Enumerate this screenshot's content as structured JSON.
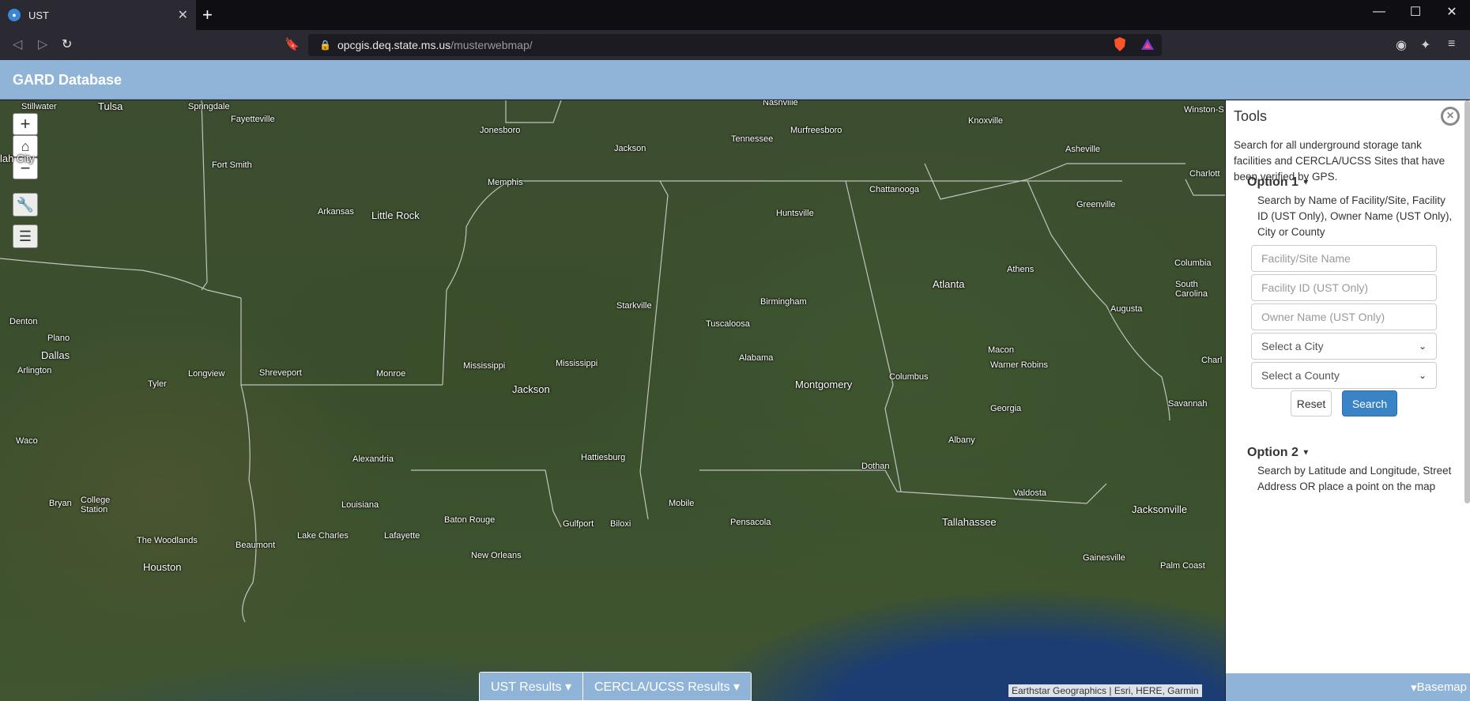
{
  "browser": {
    "tab_title": "UST",
    "new_tab": "+",
    "url_host": "opcgis.deq.state.ms.us",
    "url_path": "/musterwebmap/"
  },
  "app": {
    "title": "GARD Database"
  },
  "map": {
    "controls": {
      "zoom_in": "+",
      "zoom_out": "−"
    },
    "labels": [
      {
        "text": "Stillwater"
      },
      {
        "text": "Tulsa"
      },
      {
        "text": "Springdale"
      },
      {
        "text": "Fayetteville"
      },
      {
        "text": "Nashville"
      },
      {
        "text": "Murfreesboro"
      },
      {
        "text": "Tennessee"
      },
      {
        "text": "Knoxville"
      },
      {
        "text": "Winston-S"
      },
      {
        "text": "Asheville"
      },
      {
        "text": "Jonesboro"
      },
      {
        "text": "Jackson"
      },
      {
        "text": "Memphis"
      },
      {
        "text": "Chattanooga"
      },
      {
        "text": "Charlott"
      },
      {
        "text": "Greenville"
      },
      {
        "text": "Fort Smith"
      },
      {
        "text": "lah City"
      },
      {
        "text": "Arkansas"
      },
      {
        "text": "Little Rock"
      },
      {
        "text": "Huntsville"
      },
      {
        "text": "Atlanta"
      },
      {
        "text": "Athens"
      },
      {
        "text": "Columbia"
      },
      {
        "text": "South Carolina"
      },
      {
        "text": "Augusta"
      },
      {
        "text": "Birmingham"
      },
      {
        "text": "Starkville"
      },
      {
        "text": "Tuscaloosa"
      },
      {
        "text": "Denton"
      },
      {
        "text": "Plano"
      },
      {
        "text": "Dallas"
      },
      {
        "text": "Arlington"
      },
      {
        "text": "Macon"
      },
      {
        "text": "Warner Robins"
      },
      {
        "text": "Mississippi"
      },
      {
        "text": "Mississippi"
      },
      {
        "text": "Alabama"
      },
      {
        "text": "Longview"
      },
      {
        "text": "Shreveport"
      },
      {
        "text": "Monroe"
      },
      {
        "text": "Columbus"
      },
      {
        "text": "Montgomery"
      },
      {
        "text": "Charl"
      },
      {
        "text": "Tyler"
      },
      {
        "text": "Jackson"
      },
      {
        "text": "Georgia"
      },
      {
        "text": "Savannah"
      },
      {
        "text": "Waco"
      },
      {
        "text": "Alexandria"
      },
      {
        "text": "Hattiesburg"
      },
      {
        "text": "Albany"
      },
      {
        "text": "Dothan"
      },
      {
        "text": "Bryan"
      },
      {
        "text": "College Station"
      },
      {
        "text": "Louisiana"
      },
      {
        "text": "Valdosta"
      },
      {
        "text": "Mobile"
      },
      {
        "text": "Baton Rouge"
      },
      {
        "text": "Gulfport"
      },
      {
        "text": "Biloxi"
      },
      {
        "text": "Pensacola"
      },
      {
        "text": "Tallahassee"
      },
      {
        "text": "Jacksonville"
      },
      {
        "text": "The Woodlands"
      },
      {
        "text": "Beaumont"
      },
      {
        "text": "Lake Charles"
      },
      {
        "text": "Lafayette"
      },
      {
        "text": "New Orleans"
      },
      {
        "text": "Houston"
      },
      {
        "text": "Gainesville"
      },
      {
        "text": "Palm Coast"
      }
    ],
    "results_buttons": [
      "UST Results",
      "CERCLA/UCSS Results"
    ],
    "attribution": "Earthstar Geographics | Esri, HERE, Garmin"
  },
  "tools": {
    "title": "Tools",
    "description": "Search for all underground storage tank facilities and CERCLA/UCSS Sites that have been verified by GPS.",
    "option1": {
      "title": "Option 1",
      "description": "Search by Name of Facility/Site, Facility ID (UST Only), Owner Name (UST Only), City or County",
      "facility_placeholder": "Facility/Site Name",
      "facility_id_placeholder": "Facility ID (UST Only)",
      "owner_placeholder": "Owner Name (UST Only)",
      "city_select": "Select a City",
      "county_select": "Select a County",
      "reset_label": "Reset",
      "search_label": "Search"
    },
    "option2": {
      "title": "Option 2",
      "description": "Search by Latitude and Longitude, Street Address OR place a point on the map"
    },
    "basemap_label": "Basemap"
  }
}
